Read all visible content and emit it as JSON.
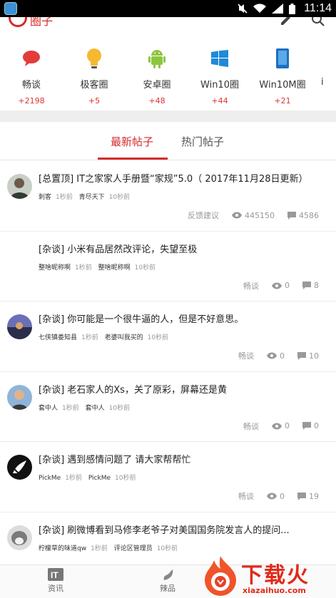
{
  "status_bar": {
    "time": "11:14",
    "icons": [
      "mute-icon",
      "wifi-icon",
      "signal-icon",
      "battery-icon"
    ]
  },
  "app_bar": {
    "brand": "圈子",
    "icons": [
      "edit-icon",
      "search-icon"
    ]
  },
  "circles": [
    {
      "name": "畅谈",
      "count": "+2198",
      "icon": "chat-bubble-icon"
    },
    {
      "name": "极客圈",
      "count": "+5",
      "icon": "lightbulb-icon"
    },
    {
      "name": "安卓圈",
      "count": "+48",
      "icon": "android-icon"
    },
    {
      "name": "Win10圈",
      "count": "+44",
      "icon": "windows-icon"
    },
    {
      "name": "Win10M圈",
      "count": "+21",
      "icon": "phone-icon"
    },
    {
      "name": "i",
      "count": "",
      "icon": ""
    }
  ],
  "tabs": [
    {
      "label": "最新帖子",
      "active": true
    },
    {
      "label": "热门帖子",
      "active": false
    }
  ],
  "posts": [
    {
      "title": "[总置顶]  IT之家家人手册暨“家规”5.0（ 2017年11月28日更新）",
      "author": "刺客",
      "author_time": "1秒前",
      "replier": "青尽天下",
      "reply_time": "10秒前",
      "category": "反馈建议",
      "views": "445150",
      "comments": "4586"
    },
    {
      "title": "[杂谈]  小米有品居然改评论，失望至极",
      "author": "整啥昵称啊",
      "author_time": "1秒前",
      "replier": "整啥昵称啊",
      "reply_time": "10秒前",
      "category": "畅谈",
      "views": "0",
      "comments": "8"
    },
    {
      "title": "[杂谈]  你可能是一个很牛逼的人，但是不好意思。",
      "author": "七侠镇娄知县",
      "author_time": "1秒前",
      "replier": "老婆叫我买的",
      "reply_time": "10秒前",
      "category": "畅谈",
      "views": "0",
      "comments": "10"
    },
    {
      "title": "[杂谈]  老石家人的Xs，关了原彩，屏幕还是黄",
      "author": "套中人",
      "author_time": "1秒前",
      "replier": "套中人",
      "reply_time": "10秒前",
      "category": "畅谈",
      "views": "0",
      "comments": "0"
    },
    {
      "title": "[杂谈]  遇到感情问题了 请大家帮帮忙",
      "author": "PickMe",
      "author_time": "1秒前",
      "replier": "PickMe",
      "reply_time": "10秒前",
      "category": "畅谈",
      "views": "0",
      "comments": "19"
    },
    {
      "title": "[杂谈]  刷微博看到马修李老爷子对美国国务院发言人的提问...",
      "author": "柠檬草的味道qw",
      "author_time": "1秒前",
      "replier": "评论区管理员",
      "reply_time": "10秒前",
      "category": "",
      "views": "",
      "comments": ""
    }
  ],
  "bottom_nav": [
    {
      "label": "资讯",
      "icon": "it-news-icon"
    },
    {
      "label": "辣品",
      "icon": "chili-icon"
    }
  ],
  "watermark": {
    "main": "下载火",
    "sub": "xiazaihuo.com"
  },
  "colors": {
    "accent": "#d62b2b",
    "count_red": "#dd3333",
    "meta_gray": "#999999"
  }
}
